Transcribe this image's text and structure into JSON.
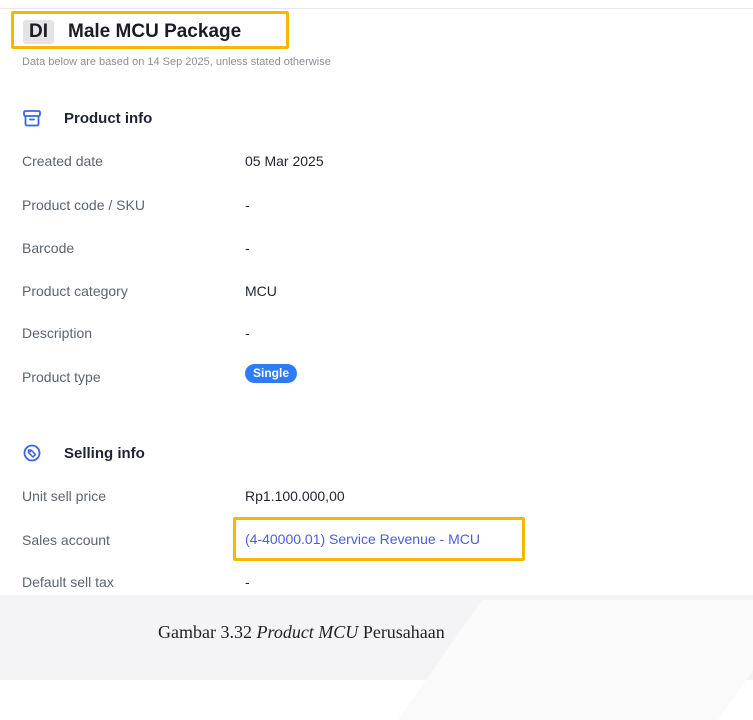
{
  "header": {
    "title_abbr": "DI",
    "title": "Male MCU Package",
    "subtitle": "Data below are based on 14 Sep 2025, unless stated otherwise"
  },
  "product_info": {
    "heading": "Product info",
    "icon": "archive-box-icon",
    "fields": [
      {
        "label": "Created date",
        "value": "05 Mar 2025"
      },
      {
        "label": "Product code / SKU",
        "value": "-"
      },
      {
        "label": "Barcode",
        "value": "-"
      },
      {
        "label": "Product category",
        "value": "MCU"
      },
      {
        "label": "Description",
        "value": "-"
      },
      {
        "label": "Product type",
        "value": "Single"
      }
    ]
  },
  "selling_info": {
    "heading": "Selling info",
    "icon": "price-tag-icon",
    "fields": [
      {
        "label": "Unit sell price",
        "value": "Rp1.100.000,00"
      },
      {
        "label": "Sales account",
        "value": "(4-40000.01) Service Revenue - MCU"
      },
      {
        "label": "Default sell tax",
        "value": "-"
      }
    ]
  },
  "caption": {
    "prefix": "Gambar 3.32 ",
    "italic": "Product MCU",
    "suffix": " Perusahaan"
  },
  "colors": {
    "highlight": "#f5b800",
    "badge": "#2f7bf5",
    "link": "#4a5fd6"
  }
}
